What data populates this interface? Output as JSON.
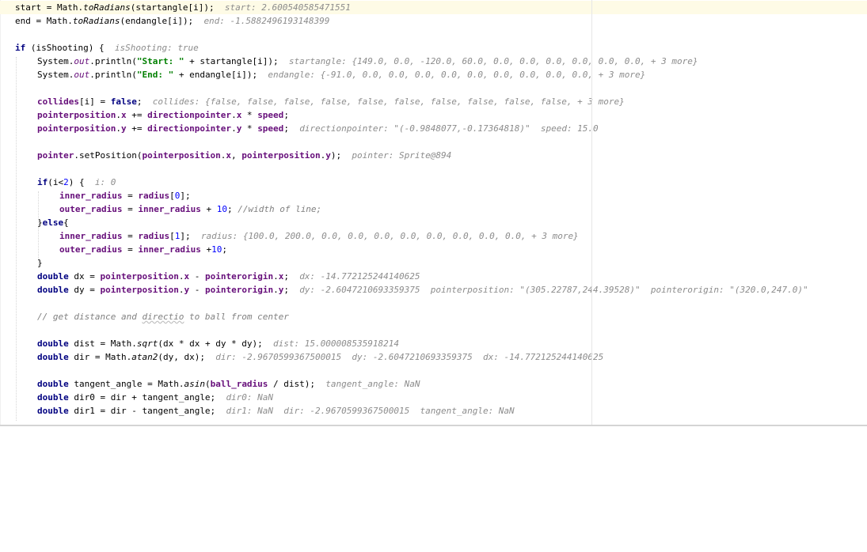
{
  "editor": {
    "lines": [
      {
        "segments": [
          {
            "t": "start = Math.",
            "c": ""
          },
          {
            "t": "toRadians",
            "c": "ital"
          },
          {
            "t": "(startangle[i]);  ",
            "c": ""
          },
          {
            "t": "start: 2.600540585471551",
            "c": "hint"
          }
        ],
        "indent": 0,
        "current": true
      },
      {
        "segments": [
          {
            "t": "end = Math.",
            "c": ""
          },
          {
            "t": "toRadians",
            "c": "ital"
          },
          {
            "t": "(endangle[i]);  ",
            "c": ""
          },
          {
            "t": "end: -1.5882496193148399",
            "c": "hint"
          }
        ],
        "indent": 0
      },
      {
        "segments": [],
        "indent": 0
      },
      {
        "segments": [
          {
            "t": "if",
            "c": "kw"
          },
          {
            "t": " (isShooting) {  ",
            "c": ""
          },
          {
            "t": "isShooting: true",
            "c": "hint"
          }
        ],
        "indent": 0
      },
      {
        "segments": [
          {
            "t": "System.",
            "c": ""
          },
          {
            "t": "out",
            "c": "fieldn ital"
          },
          {
            "t": ".println(",
            "c": ""
          },
          {
            "t": "\"Start: \"",
            "c": "str"
          },
          {
            "t": " + startangle[i]);  ",
            "c": ""
          },
          {
            "t": "startangle: {149.0, 0.0, -120.0, 60.0, 0.0, 0.0, 0.0, 0.0, 0.0, 0.0, + 3 more}",
            "c": "hint"
          }
        ],
        "indent": 1
      },
      {
        "segments": [
          {
            "t": "System.",
            "c": ""
          },
          {
            "t": "out",
            "c": "fieldn ital"
          },
          {
            "t": ".println(",
            "c": ""
          },
          {
            "t": "\"End: \"",
            "c": "str"
          },
          {
            "t": " + endangle[i]);  ",
            "c": ""
          },
          {
            "t": "endangle: {-91.0, 0.0, 0.0, 0.0, 0.0, 0.0, 0.0, 0.0, 0.0, 0.0, + 3 more}",
            "c": "hint"
          }
        ],
        "indent": 1
      },
      {
        "segments": [],
        "indent": 0
      },
      {
        "segments": [
          {
            "t": "collides",
            "c": "field"
          },
          {
            "t": "[i] = ",
            "c": ""
          },
          {
            "t": "false",
            "c": "kw"
          },
          {
            "t": ";  ",
            "c": ""
          },
          {
            "t": "collides: {false, false, false, false, false, false, false, false, false, false, + 3 more}",
            "c": "hint"
          }
        ],
        "indent": 1
      },
      {
        "segments": [
          {
            "t": "pointerposition",
            "c": "field"
          },
          {
            "t": ".",
            "c": ""
          },
          {
            "t": "x",
            "c": "field"
          },
          {
            "t": " += ",
            "c": ""
          },
          {
            "t": "directionpointer",
            "c": "field"
          },
          {
            "t": ".",
            "c": ""
          },
          {
            "t": "x",
            "c": "field"
          },
          {
            "t": " * ",
            "c": ""
          },
          {
            "t": "speed",
            "c": "field"
          },
          {
            "t": ";",
            "c": ""
          }
        ],
        "indent": 1
      },
      {
        "segments": [
          {
            "t": "pointerposition",
            "c": "field"
          },
          {
            "t": ".",
            "c": ""
          },
          {
            "t": "y",
            "c": "field"
          },
          {
            "t": " += ",
            "c": ""
          },
          {
            "t": "directionpointer",
            "c": "field"
          },
          {
            "t": ".",
            "c": ""
          },
          {
            "t": "y",
            "c": "field"
          },
          {
            "t": " * ",
            "c": ""
          },
          {
            "t": "speed",
            "c": "field"
          },
          {
            "t": ";  ",
            "c": ""
          },
          {
            "t": "directionpointer: \"(-0.9848077,-0.17364818)\"  speed: 15.0",
            "c": "hint"
          }
        ],
        "indent": 1
      },
      {
        "segments": [],
        "indent": 0
      },
      {
        "segments": [
          {
            "t": "pointer",
            "c": "field"
          },
          {
            "t": ".setPosition(",
            "c": ""
          },
          {
            "t": "pointerposition",
            "c": "field"
          },
          {
            "t": ".",
            "c": ""
          },
          {
            "t": "x",
            "c": "field"
          },
          {
            "t": ", ",
            "c": ""
          },
          {
            "t": "pointerposition",
            "c": "field"
          },
          {
            "t": ".",
            "c": ""
          },
          {
            "t": "y",
            "c": "field"
          },
          {
            "t": ");  ",
            "c": ""
          },
          {
            "t": "pointer: Sprite@894",
            "c": "hint"
          }
        ],
        "indent": 1
      },
      {
        "segments": [],
        "indent": 0
      },
      {
        "segments": [
          {
            "t": "if",
            "c": "kw"
          },
          {
            "t": "(i<",
            "c": ""
          },
          {
            "t": "2",
            "c": "num"
          },
          {
            "t": ") {  ",
            "c": ""
          },
          {
            "t": "i: 0",
            "c": "hint"
          }
        ],
        "indent": 1
      },
      {
        "segments": [
          {
            "t": "inner_radius",
            "c": "field"
          },
          {
            "t": " = ",
            "c": ""
          },
          {
            "t": "radius",
            "c": "field"
          },
          {
            "t": "[",
            "c": ""
          },
          {
            "t": "0",
            "c": "num"
          },
          {
            "t": "];",
            "c": ""
          }
        ],
        "indent": 2
      },
      {
        "segments": [
          {
            "t": "outer_radius",
            "c": "field"
          },
          {
            "t": " = ",
            "c": ""
          },
          {
            "t": "inner_radius",
            "c": "field"
          },
          {
            "t": " + ",
            "c": ""
          },
          {
            "t": "10",
            "c": "num"
          },
          {
            "t": "; ",
            "c": ""
          },
          {
            "t": "//width of line;",
            "c": "cm"
          }
        ],
        "indent": 2
      },
      {
        "segments": [
          {
            "t": "}",
            "c": ""
          },
          {
            "t": "else",
            "c": "kw"
          },
          {
            "t": "{",
            "c": ""
          }
        ],
        "indent": 1
      },
      {
        "segments": [
          {
            "t": "inner_radius",
            "c": "field"
          },
          {
            "t": " = ",
            "c": ""
          },
          {
            "t": "radius",
            "c": "field"
          },
          {
            "t": "[",
            "c": ""
          },
          {
            "t": "1",
            "c": "num"
          },
          {
            "t": "];  ",
            "c": ""
          },
          {
            "t": "radius: {100.0, 200.0, 0.0, 0.0, 0.0, 0.0, 0.0, 0.0, 0.0, 0.0, + 3 more}",
            "c": "hint"
          }
        ],
        "indent": 2
      },
      {
        "segments": [
          {
            "t": "outer_radius",
            "c": "field"
          },
          {
            "t": " = ",
            "c": ""
          },
          {
            "t": "inner_radius",
            "c": "field"
          },
          {
            "t": " +",
            "c": ""
          },
          {
            "t": "10",
            "c": "num"
          },
          {
            "t": ";",
            "c": ""
          }
        ],
        "indent": 2
      },
      {
        "segments": [
          {
            "t": "}",
            "c": ""
          }
        ],
        "indent": 1
      },
      {
        "segments": [
          {
            "t": "double",
            "c": "kw"
          },
          {
            "t": " dx = ",
            "c": ""
          },
          {
            "t": "pointerposition",
            "c": "field"
          },
          {
            "t": ".",
            "c": ""
          },
          {
            "t": "x",
            "c": "field"
          },
          {
            "t": " - ",
            "c": ""
          },
          {
            "t": "pointerorigin",
            "c": "field"
          },
          {
            "t": ".",
            "c": ""
          },
          {
            "t": "x",
            "c": "field"
          },
          {
            "t": ";  ",
            "c": ""
          },
          {
            "t": "dx: -14.772125244140625",
            "c": "hint"
          }
        ],
        "indent": 1
      },
      {
        "segments": [
          {
            "t": "double",
            "c": "kw"
          },
          {
            "t": " dy = ",
            "c": ""
          },
          {
            "t": "pointerposition",
            "c": "field"
          },
          {
            "t": ".",
            "c": ""
          },
          {
            "t": "y",
            "c": "field"
          },
          {
            "t": " - ",
            "c": ""
          },
          {
            "t": "pointerorigin",
            "c": "field"
          },
          {
            "t": ".",
            "c": ""
          },
          {
            "t": "y",
            "c": "field"
          },
          {
            "t": ";  ",
            "c": ""
          },
          {
            "t": "dy: -2.6047210693359375  pointerposition: \"(305.22787,244.39528)\"  pointerorigin: \"(320.0,247.0)\"",
            "c": "hint"
          }
        ],
        "indent": 1
      },
      {
        "segments": [],
        "indent": 0
      },
      {
        "segments": [
          {
            "t": "// get distance and ",
            "c": "cm"
          },
          {
            "t": "directio",
            "c": "cm squig"
          },
          {
            "t": " to ball from center",
            "c": "cm"
          }
        ],
        "indent": 1
      },
      {
        "segments": [],
        "indent": 0
      },
      {
        "segments": [
          {
            "t": "double",
            "c": "kw"
          },
          {
            "t": " dist = Math.",
            "c": ""
          },
          {
            "t": "sqrt",
            "c": "ital"
          },
          {
            "t": "(dx * dx + dy * dy);  ",
            "c": ""
          },
          {
            "t": "dist: 15.000008535918214",
            "c": "hint"
          }
        ],
        "indent": 1
      },
      {
        "segments": [
          {
            "t": "double",
            "c": "kw"
          },
          {
            "t": " dir = Math.",
            "c": ""
          },
          {
            "t": "atan2",
            "c": "ital"
          },
          {
            "t": "(dy, dx);  ",
            "c": ""
          },
          {
            "t": "dir: -2.9670599367500015  dy: -2.6047210693359375  dx: -14.772125244140625",
            "c": "hint"
          }
        ],
        "indent": 1
      },
      {
        "segments": [],
        "indent": 0
      },
      {
        "segments": [
          {
            "t": "double",
            "c": "kw"
          },
          {
            "t": " tangent_angle = Math.",
            "c": ""
          },
          {
            "t": "asin",
            "c": "ital"
          },
          {
            "t": "(",
            "c": ""
          },
          {
            "t": "ball_radius",
            "c": "field"
          },
          {
            "t": " / dist);  ",
            "c": ""
          },
          {
            "t": "tangent_angle: NaN",
            "c": "hint"
          }
        ],
        "indent": 1
      },
      {
        "segments": [
          {
            "t": "double",
            "c": "kw"
          },
          {
            "t": " dir0 = dir + tangent_angle;  ",
            "c": ""
          },
          {
            "t": "dir0: NaN",
            "c": "hint"
          }
        ],
        "indent": 1
      },
      {
        "segments": [
          {
            "t": "double",
            "c": "kw"
          },
          {
            "t": " dir1 = dir - tangent_angle;  ",
            "c": ""
          },
          {
            "t": "dir1: NaN  dir: -2.9670599367500015  tangent_angle: NaN",
            "c": "hint"
          }
        ],
        "indent": 1
      }
    ]
  }
}
